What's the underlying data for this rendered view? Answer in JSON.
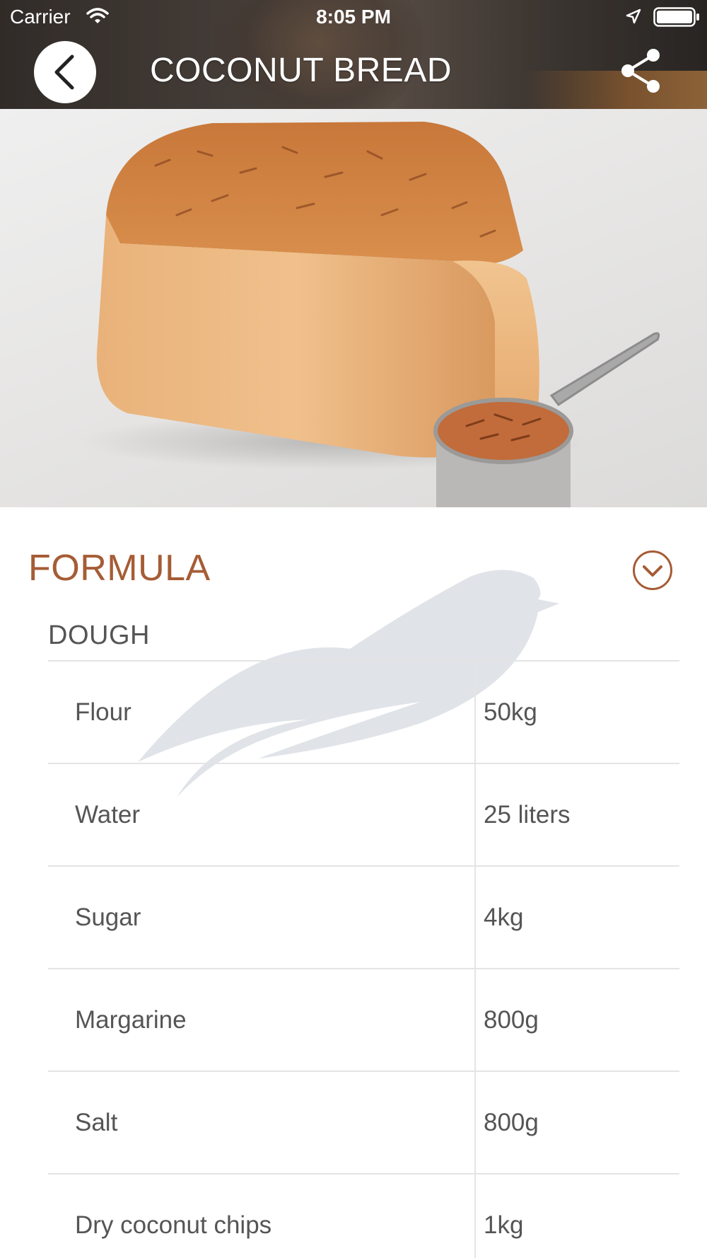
{
  "status_bar": {
    "carrier": "Carrier",
    "time": "8:05 PM"
  },
  "header": {
    "title": "COCONUT BREAD",
    "back_icon": "chevron-left-icon",
    "share_icon": "share-icon"
  },
  "formula": {
    "title": "FORMULA",
    "toggle_icon": "chevron-down-circle-icon",
    "dough": {
      "title": "DOUGH",
      "ingredients": [
        {
          "name": "Flour",
          "amount": "50kg"
        },
        {
          "name": "Water",
          "amount": "25 liters"
        },
        {
          "name": "Sugar",
          "amount": "4kg"
        },
        {
          "name": "Margarine",
          "amount": "800g"
        },
        {
          "name": "Salt",
          "amount": "800g"
        },
        {
          "name": "Dry coconut chips",
          "amount": "1kg"
        }
      ]
    }
  },
  "colors": {
    "accent": "#a65c35",
    "text": "#555555",
    "divider": "#e4e4e4",
    "watermark": "#dde0e6"
  }
}
